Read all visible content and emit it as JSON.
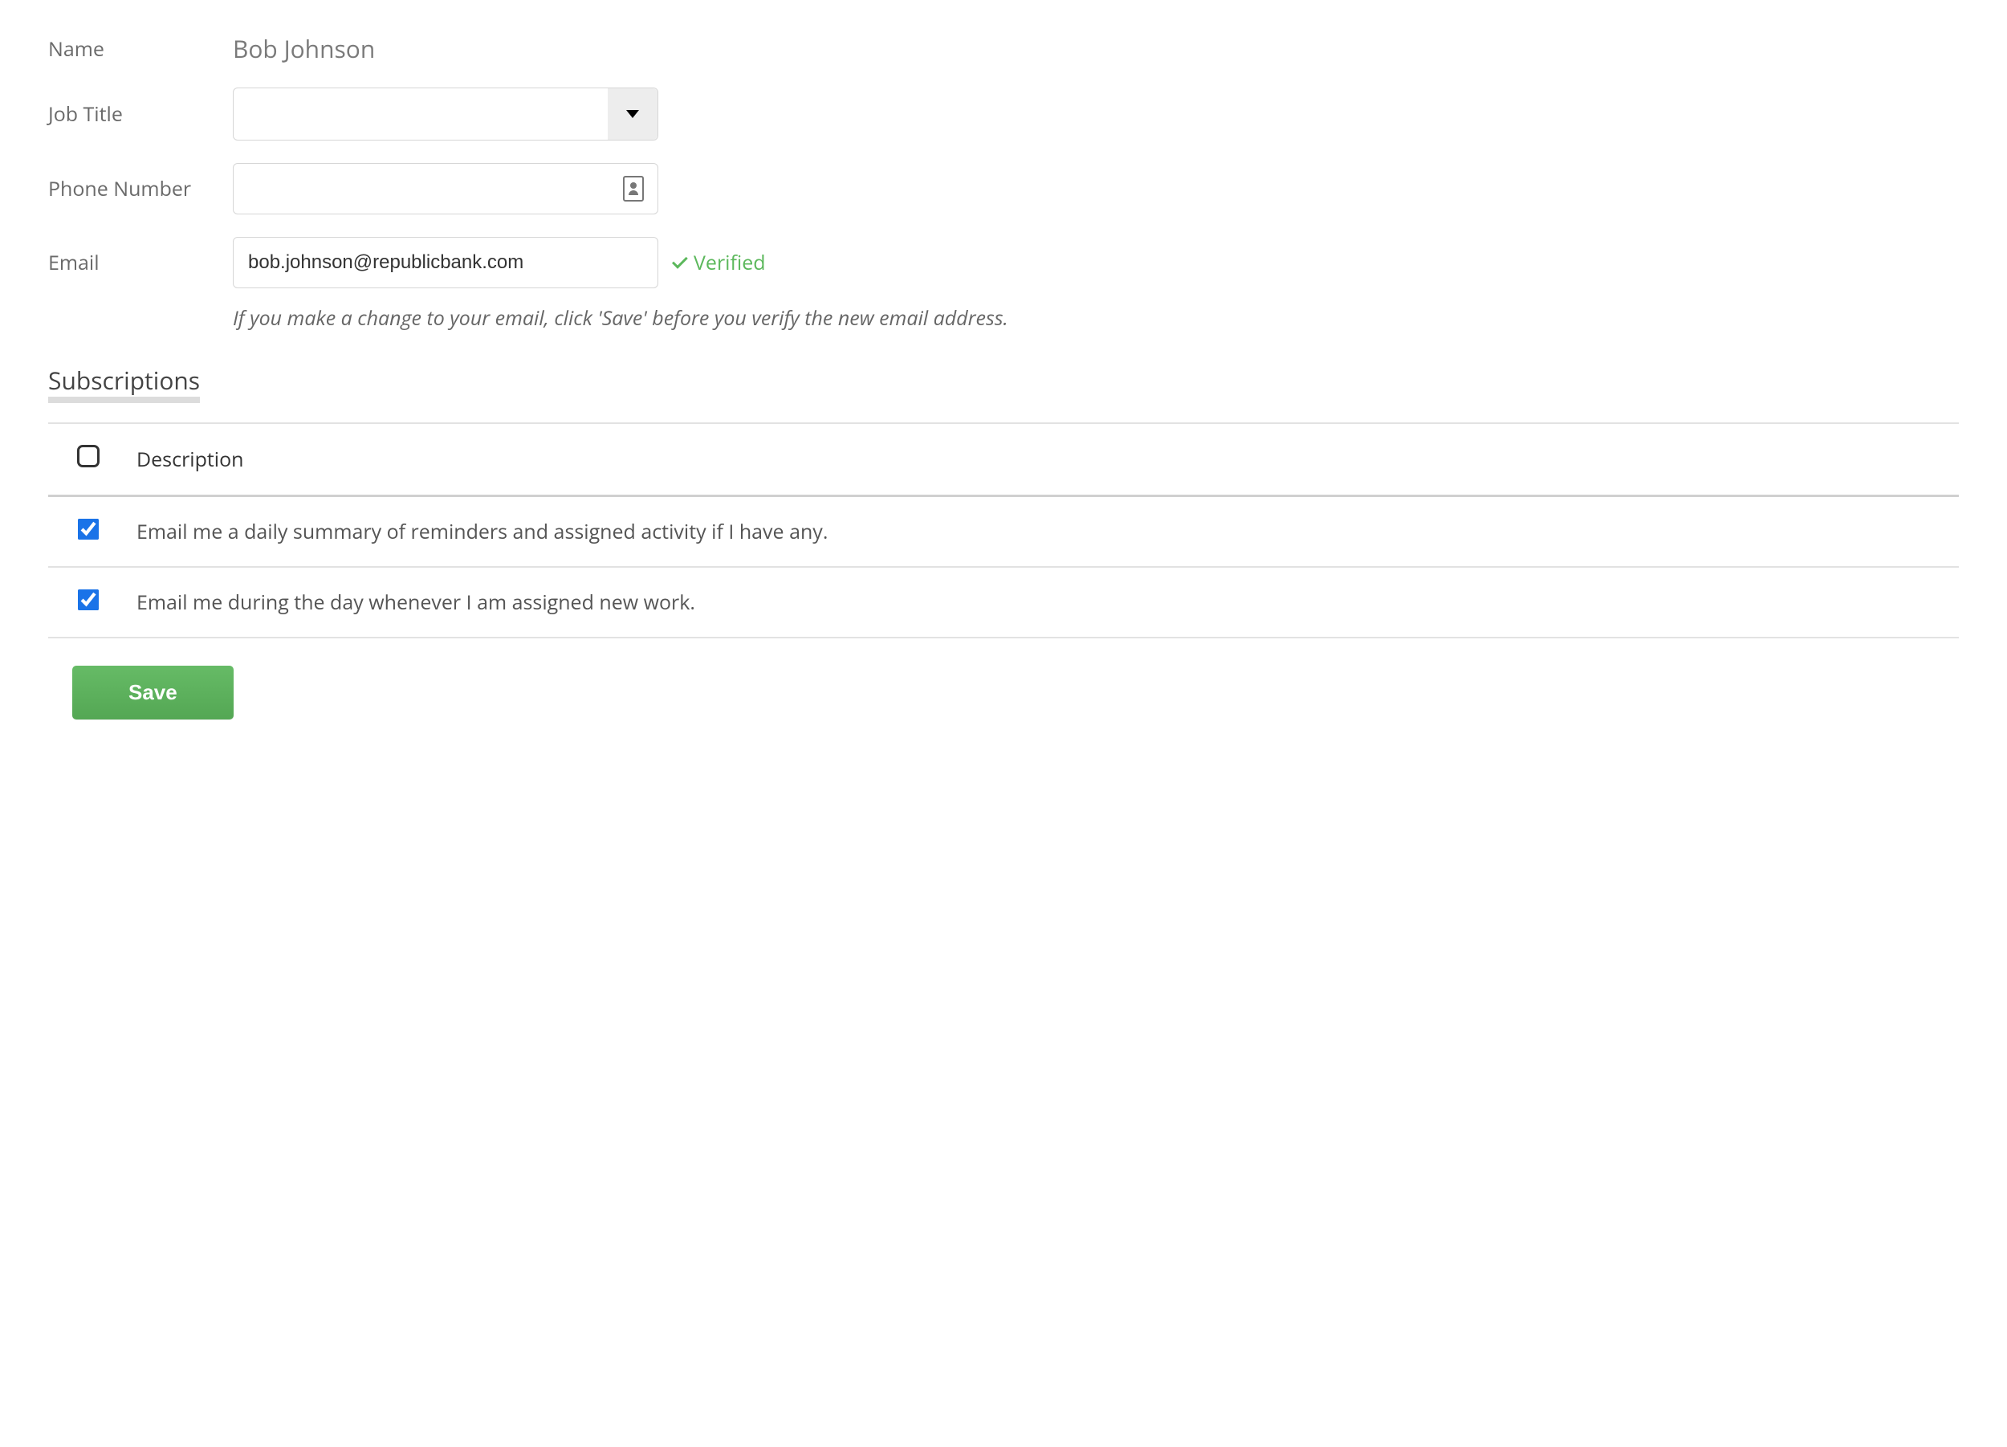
{
  "form": {
    "name_label": "Name",
    "name_value": "Bob Johnson",
    "job_title_label": "Job Title",
    "job_title_value": "",
    "phone_label": "Phone Number",
    "phone_value": "",
    "email_label": "Email",
    "email_value": "bob.johnson@republicbank.com",
    "verified_text": "Verified",
    "email_hint": "If you make a change to your email, click 'Save' before you verify the new email address."
  },
  "subscriptions": {
    "section_title": "Subscriptions",
    "header_description": "Description",
    "rows": [
      {
        "checked": true,
        "description": "Email me a daily summary of reminders and assigned activity if I have any."
      },
      {
        "checked": true,
        "description": "Email me during the day whenever I am assigned new work."
      }
    ]
  },
  "actions": {
    "save_label": "Save"
  }
}
